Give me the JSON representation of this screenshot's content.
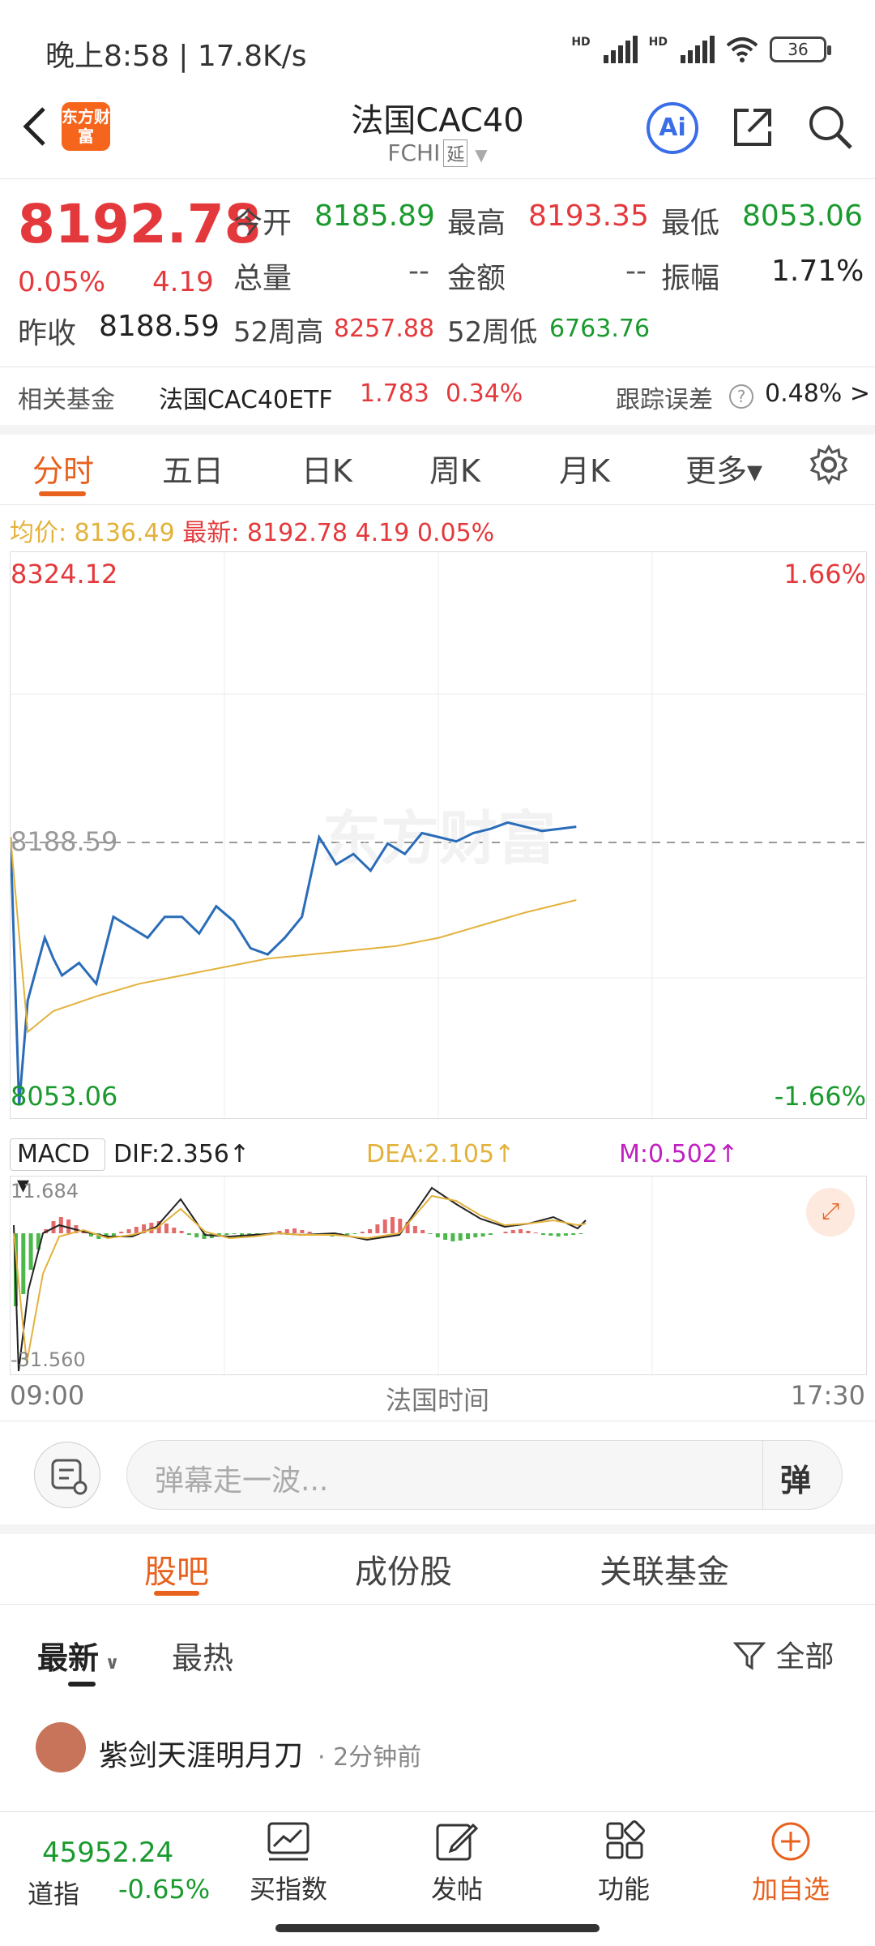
{
  "status_bar": {
    "time": "晚上8:58 | 17.8K/s",
    "network1": "HD",
    "network2": "HD",
    "battery": "36"
  },
  "header": {
    "logo_text": "东方财富",
    "title": "法国CAC40",
    "code": "FCHI",
    "delay_tag": "延"
  },
  "quote": {
    "price": "8192.78",
    "change_pct": "0.05%",
    "change": "4.19",
    "open_label": "今开",
    "open": "8185.89",
    "high_label": "最高",
    "high": "8193.35",
    "low_label": "最低",
    "low": "8053.06",
    "volume_label": "总量",
    "volume": "--",
    "amount_label": "金额",
    "amount": "--",
    "amplitude_label": "振幅",
    "amplitude": "1.71%",
    "prev_close_label": "昨收",
    "prev_close": "8188.59",
    "w52_high_label": "52周高",
    "w52_high": "8257.88",
    "w52_low_label": "52周低",
    "w52_low": "6763.76"
  },
  "fund": {
    "label": "相关基金",
    "name": "法国CAC40ETF",
    "price": "1.783",
    "change": "0.34%",
    "tracking_label": "跟踪误差",
    "tracking": "0.48% >"
  },
  "tabs": [
    {
      "label": "分时",
      "active": true
    },
    {
      "label": "五日"
    },
    {
      "label": "日K"
    },
    {
      "label": "周K"
    },
    {
      "label": "月K"
    },
    {
      "label": "更多▾"
    }
  ],
  "avg_bar": {
    "avg_label": "均价:",
    "avg": "8136.49",
    "latest_label": "最新:",
    "latest": "8192.78",
    "change": "4.19",
    "pct": "0.05%"
  },
  "chart_axis": {
    "top_price": "8324.12",
    "top_pct": "1.66%",
    "ref_price": "8188.59",
    "bottom_price": "8053.06",
    "bottom_pct": "-1.66%",
    "watermark": "东方财富",
    "time_start": "09:00",
    "time_mid": "法国时间",
    "time_end": "17:30"
  },
  "chart_data": {
    "type": "line",
    "title": "",
    "ylim": [
      8053.06,
      8324.12
    ],
    "x_range": [
      "09:00",
      "17:30"
    ],
    "series": [
      {
        "name": "最新",
        "color": "#2a6cb8",
        "x": [
          0,
          0.01,
          0.02,
          0.03,
          0.04,
          0.05,
          0.06,
          0.08,
          0.1,
          0.12,
          0.14,
          0.16,
          0.18,
          0.2,
          0.22,
          0.24,
          0.26,
          0.28,
          0.3,
          0.32,
          0.34,
          0.36,
          0.38,
          0.4,
          0.42,
          0.44,
          0.46,
          0.48,
          0.5,
          0.52,
          0.54,
          0.56,
          0.58,
          0.6,
          0.62,
          0.64,
          0.66
        ],
        "y": [
          8188,
          8060,
          8110,
          8125,
          8140,
          8130,
          8122,
          8128,
          8118,
          8150,
          8145,
          8140,
          8150,
          8150,
          8142,
          8155,
          8148,
          8135,
          8132,
          8140,
          8150,
          8188,
          8175,
          8180,
          8172,
          8185,
          8180,
          8190,
          8188,
          8186,
          8190,
          8192,
          8195,
          8193,
          8191,
          8192,
          8193
        ]
      },
      {
        "name": "均价",
        "color": "#e3b23c",
        "x": [
          0,
          0.02,
          0.05,
          0.1,
          0.15,
          0.2,
          0.25,
          0.3,
          0.35,
          0.4,
          0.45,
          0.5,
          0.55,
          0.6,
          0.66
        ],
        "y": [
          8188,
          8095,
          8105,
          8112,
          8118,
          8122,
          8126,
          8130,
          8132,
          8134,
          8136,
          8140,
          8146,
          8152,
          8158
        ]
      }
    ],
    "macd": {
      "dif": "DIF:2.356↑",
      "dea": "DEA:2.105↑",
      "m": "M:0.502↑",
      "max": "11.684",
      "min": "-31.560"
    }
  },
  "comment": {
    "placeholder": "弹幕走一波...",
    "danmu": "弹"
  },
  "post_tabs": [
    "股吧",
    "成份股",
    "关联基金"
  ],
  "post_filter": {
    "latest": "最新",
    "hot": "最热",
    "all": "全部"
  },
  "post": {
    "author": "紫剑天涯明月刀",
    "time": "· 2分钟前"
  },
  "bottom": {
    "index_value": "45952.24",
    "index_name": "道指",
    "index_change": "-0.65%",
    "buy": "买指数",
    "post": "发帖",
    "func": "功能",
    "add": "加自选"
  }
}
